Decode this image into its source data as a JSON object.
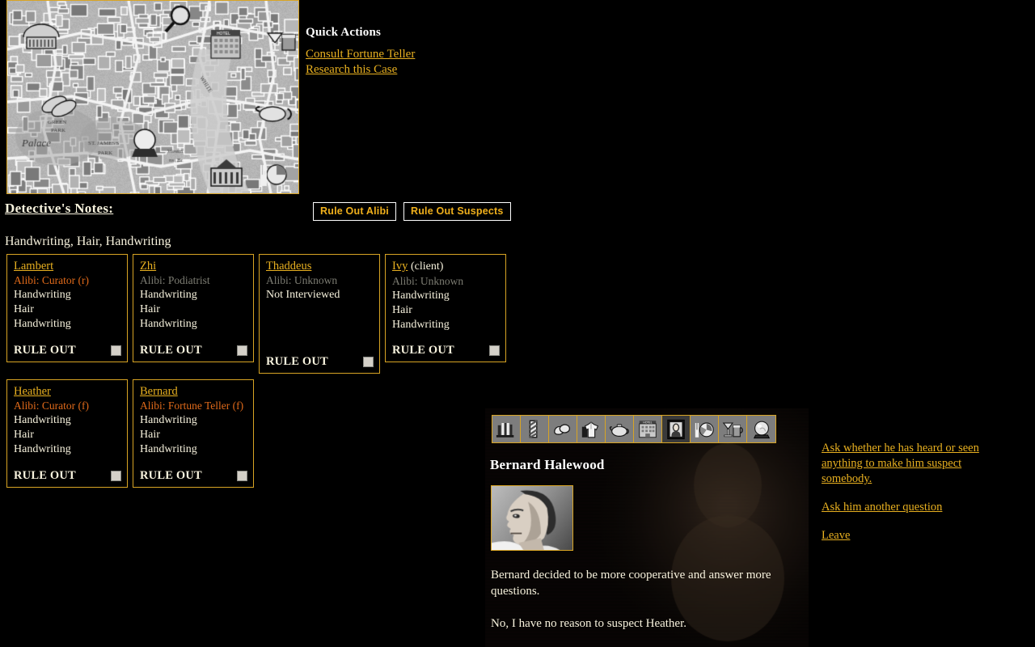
{
  "map": {
    "alt": "victorian-london-map",
    "border_color": "#d8a424",
    "icons": [
      "theatre",
      "magnifier",
      "hotel",
      "pub",
      "shoes",
      "teapot",
      "crystal-ball",
      "library",
      "restaurant"
    ]
  },
  "quick_actions": {
    "title": "Quick Actions",
    "links": [
      {
        "label": "Consult Fortune Teller"
      },
      {
        "label": "Research this Case"
      }
    ]
  },
  "notes": {
    "title": "Detective's Notes:",
    "evidence_summary": "Handwriting, Hair, Handwriting",
    "buttons": [
      {
        "label": "Rule Out Alibi"
      },
      {
        "label": "Rule Out Suspects"
      }
    ],
    "rule_out_label": "RULE OUT"
  },
  "suspects": [
    {
      "name": "Lambert",
      "tag": "",
      "alibi_label": "Alibi:",
      "alibi_value": "Curator (r)",
      "alibi_state": "confirmed",
      "evidence": [
        "Handwriting",
        "Hair",
        "Handwriting"
      ],
      "ruled_out": false
    },
    {
      "name": "Zhi",
      "tag": "",
      "alibi_label": "Alibi:",
      "alibi_value": "Podiatrist",
      "alibi_state": "unknown",
      "evidence": [
        "Handwriting",
        "Hair",
        "Handwriting"
      ],
      "ruled_out": false
    },
    {
      "name": "Thaddeus",
      "tag": "",
      "alibi_label": "Alibi:",
      "alibi_value": "Unknown",
      "alibi_state": "unknown",
      "evidence": [
        "Not Interviewed"
      ],
      "ruled_out": false
    },
    {
      "name": "Ivy",
      "tag": "(client)",
      "alibi_label": "Alibi:",
      "alibi_value": "Unknown",
      "alibi_state": "unknown",
      "evidence": [
        "Handwriting",
        "Hair",
        "Handwriting"
      ],
      "ruled_out": false
    },
    {
      "name": "Heather",
      "tag": "",
      "alibi_label": "Alibi:",
      "alibi_value": "Curator (f)",
      "alibi_state": "confirmed",
      "evidence": [
        "Handwriting",
        "Hair",
        "Handwriting"
      ],
      "ruled_out": false
    },
    {
      "name": "Bernard",
      "tag": "",
      "alibi_label": "Alibi:",
      "alibi_value": "Fortune Teller (f)",
      "alibi_state": "confirmed",
      "evidence": [
        "Handwriting",
        "Hair",
        "Handwriting"
      ],
      "ruled_out": false
    }
  ],
  "interview": {
    "character_name": "Bernard Halewood",
    "portrait_alt": "bernard-halewood-portrait",
    "dialogue": [
      "Bernard decided to be more cooperative and answer more questions.",
      "No, I have no reason to suspect Heather."
    ],
    "options": [
      {
        "label": "Ask whether he has heard or seen anything to make him suspect somebody."
      },
      {
        "label": "Ask him another question"
      },
      {
        "label": "Leave"
      }
    ],
    "locations": [
      {
        "icon": "library-icon",
        "name": "Library",
        "selected": false
      },
      {
        "icon": "barber-pole-icon",
        "name": "Barber",
        "selected": false
      },
      {
        "icon": "shoes-icon",
        "name": "Cobbler",
        "selected": false
      },
      {
        "icon": "laundry-shirt-icon",
        "name": "Laundry",
        "selected": false
      },
      {
        "icon": "teapot-icon",
        "name": "Tea Shop",
        "selected": false
      },
      {
        "icon": "hotel-icon",
        "name": "Hotel",
        "selected": false
      },
      {
        "icon": "art-gallery-icon",
        "name": "Art Gallery",
        "selected": true
      },
      {
        "icon": "restaurant-icon",
        "name": "Restaurant",
        "selected": false
      },
      {
        "icon": "pub-icon",
        "name": "Pub",
        "selected": false
      },
      {
        "icon": "crystal-ball-icon",
        "name": "Fortune Teller",
        "selected": false
      }
    ]
  },
  "colors": {
    "accent": "#e8b020",
    "border": "#d8a424",
    "confirmed_alibi": "#e06a1a",
    "unknown_alibi": "#7d7d73",
    "text": "#f7f2dd",
    "background": "#000000"
  }
}
